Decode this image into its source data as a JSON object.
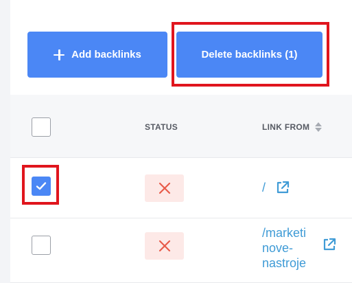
{
  "toolbar": {
    "add_label": "Add backlinks",
    "delete_label": "Delete backlinks (1)"
  },
  "table": {
    "columns": [
      "STATUS",
      "LINK FROM"
    ],
    "rows": [
      {
        "checked": true,
        "status": "error",
        "link_lines": [
          "/"
        ]
      },
      {
        "checked": false,
        "status": "error",
        "link_lines": [
          "/marketi",
          "nove-",
          "nastroje"
        ]
      }
    ]
  },
  "colors": {
    "primary": "#4b87f5",
    "highlight": "#e0151d",
    "status_error_bg": "#fde9e7",
    "status_error_icon": "#e85a49",
    "link": "#3f9bd6"
  }
}
